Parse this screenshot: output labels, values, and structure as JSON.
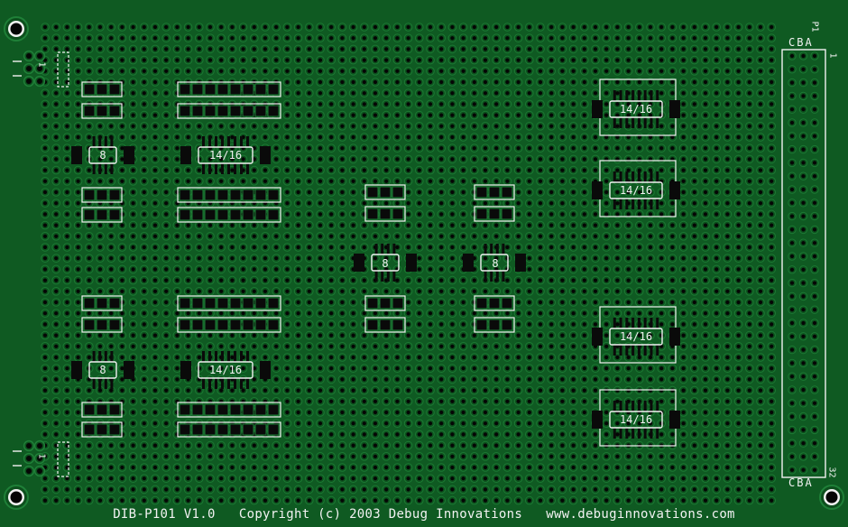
{
  "board": {
    "model": "DIB-P101",
    "version": "V1.0",
    "copyright": "Copyright (c) 2003 Debug Innovations",
    "website": "www.debuginnovations.com",
    "connector": {
      "ref": "P1",
      "rows": "CBA",
      "first_pin": "1",
      "last_pin": "32"
    },
    "left_header_mark": "1",
    "footprints": {
      "dip8": "8",
      "dip14_16": "14/16"
    }
  },
  "colors": {
    "board": "#0f5a22",
    "silkscreen": "#f2f2f2",
    "pad": "#0a0a0a"
  }
}
